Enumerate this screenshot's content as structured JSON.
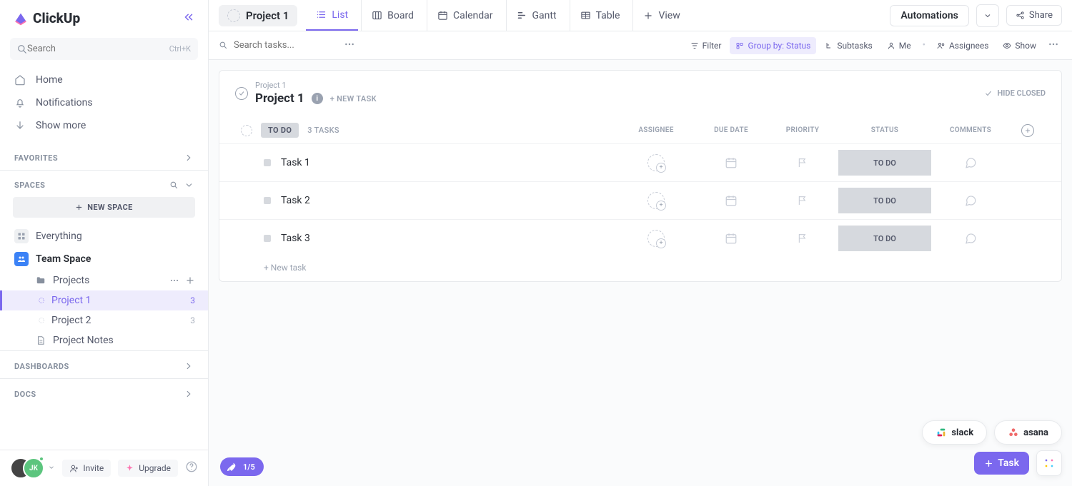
{
  "brand": "ClickUp",
  "sidebar": {
    "search_placeholder": "Search",
    "search_kbd": "Ctrl+K",
    "nav": {
      "home": "Home",
      "notifications": "Notifications",
      "more": "Show more"
    },
    "favorites_label": "FAVORITES",
    "spaces_label": "SPACES",
    "new_space": "NEW SPACE",
    "everything": "Everything",
    "team_space": "Team Space",
    "projects_folder": "Projects",
    "project1": {
      "name": "Project 1",
      "count": "3"
    },
    "project2": {
      "name": "Project 2",
      "count": "3"
    },
    "project_notes": "Project Notes",
    "dashboards_label": "DASHBOARDS",
    "docs_label": "DOCS",
    "avatar_initials": "JK",
    "invite": "Invite",
    "upgrade": "Upgrade"
  },
  "topbar": {
    "project_name": "Project 1",
    "views": {
      "list": "List",
      "board": "Board",
      "calendar": "Calendar",
      "gantt": "Gantt",
      "table": "Table",
      "add_view": "View"
    },
    "automations": "Automations",
    "share": "Share"
  },
  "filterbar": {
    "search_placeholder": "Search tasks...",
    "filter": "Filter",
    "group_by": "Group by: Status",
    "subtasks": "Subtasks",
    "me": "Me",
    "assignees": "Assignees",
    "show": "Show"
  },
  "list": {
    "breadcrumb": "Project 1",
    "title": "Project 1",
    "new_task_hdr": "+ NEW TASK",
    "hide_closed": "HIDE CLOSED",
    "group": {
      "name": "TO DO",
      "count": "3 TASKS"
    },
    "cols": {
      "assignee": "ASSIGNEE",
      "due": "DUE DATE",
      "prio": "PRIORITY",
      "status": "STATUS",
      "comments": "COMMENTS"
    },
    "tasks": [
      {
        "name": "Task 1",
        "status": "TO DO"
      },
      {
        "name": "Task 2",
        "status": "TO DO"
      },
      {
        "name": "Task 3",
        "status": "TO DO"
      }
    ],
    "new_task_row": "+ New task"
  },
  "floats": {
    "onboard": "1/5",
    "slack": "slack",
    "asana": "asana",
    "task_btn": "Task"
  }
}
